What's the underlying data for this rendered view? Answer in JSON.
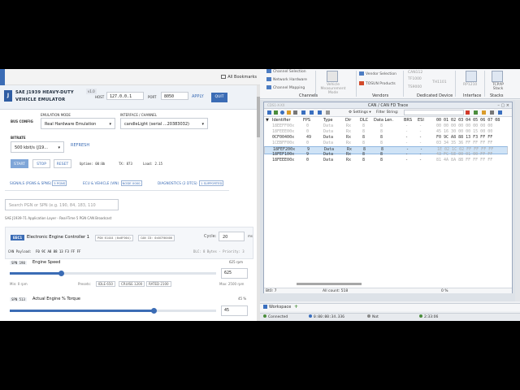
{
  "left": {
    "bookmarks_label": "All Bookmarks",
    "app": {
      "logo_letter": "J",
      "title_line1": "SAE J1939 HEAVY-DUTY",
      "title_line2": "VEHICLE EMULATOR",
      "version": "v1.0",
      "host_label": "HOST",
      "host_value": "127.0.0.1",
      "port_label": "PORT",
      "port_value": "8050",
      "apply_label": "APPLY",
      "quit_label": "QUIT"
    },
    "bus_config": {
      "section_label": "BUS CONFIG",
      "emulation_mode_label": "EMULATION MODE",
      "emulation_mode_value": "Real Hardware Emulation",
      "interface_label": "INTERFACE / CHANNEL",
      "interface_value": "candleLight (serial ...20383032)",
      "bitrate_label": "BITRATE",
      "bitrate_value": "500 kbit/s (J19...",
      "refresh_label": "REFRESH",
      "start_label": "START",
      "stop_label": "STOP",
      "reset_label": "RESET",
      "uptime": "Uptime: 00:0b",
      "tx": "TX: 873",
      "load": "Load: 2.15"
    },
    "tabs": [
      {
        "label": "SIGNALS (PGNS & SPNS)",
        "count": "5 PGNS"
      },
      {
        "label": "ECU & VEHICLE (VIN)",
        "count": "NODE 0000"
      },
      {
        "label": "DIAGNOSTICS (2 DTCS)",
        "count": "1 SUPPORTED"
      }
    ],
    "search_placeholder": "Search PGN or SPN (e.g. 190, 84, 183, 110",
    "app_layer_line": "SAE J1939-71 Application Layer - Real-Time 5 PGN CAN Broadcast",
    "ecu_card": {
      "tag": "EEC1",
      "name": "Electronic Engine Controller 1",
      "pgn_pill": "PGN 61444 (0x0F004)",
      "can_pill": "CAN ID: 0x0CF00400",
      "cycle_label": "Cycle:",
      "cycle_value": "20",
      "cycle_unit": "ms",
      "payload_label": "CAN Payload:",
      "payload_value": "F0 9C A8 88 13 F3 FF FF",
      "dlc_line": "DLC: 8 Bytes - Priority: 3"
    },
    "signals": [
      {
        "spn": "SPN 190",
        "name": "Engine Speed",
        "value_text": "625 rpm",
        "input_value": "625",
        "min_label": "Min: 0 rpm",
        "max_label": "Max: 2500 rpm",
        "presets_label": "Presets:",
        "presets": [
          "IDLE 650",
          "CRUISE 1200",
          "RATED 2100"
        ],
        "level": 0.25
      },
      {
        "spn": "SPN 513",
        "name": "Actual Engine % Torque",
        "value_text": "45 %",
        "input_value": "45",
        "level": 0.7
      }
    ]
  },
  "right": {
    "ribbon": {
      "channel_items": [
        "Channel Selection",
        "Network Hardware",
        "Channel Mapping"
      ],
      "vehicle_btn": "Vehicle Measurement Mode",
      "vendor_items": [
        "Vendor Selection",
        "TOSUN Products"
      ],
      "dedicated_items": [
        "CAN112",
        "TF1000",
        "TH1101",
        "TS9000"
      ],
      "interface_item": "RP1210",
      "stacks_item": "TCP/IP Stack",
      "groups": [
        "Channels",
        "Vendors",
        "Dedicated Device",
        "Interface",
        "Stacks"
      ]
    },
    "trace": {
      "title": "CAN / CAN FD Trace",
      "subtitle": "CDS1-X-XX",
      "settings_label": "Settings",
      "filter_label": "Filter String:",
      "columns": [
        "Identifier",
        "FPS",
        "Type",
        "Dir",
        "DLC",
        "Data Len.",
        "BRS",
        "ESI",
        "00 01 02 03 04 05 06 07 08"
      ],
      "rows": [
        {
          "id": "18EEFF00x",
          "fps": "0",
          "type": "Data",
          "dir": "Rx",
          "dlc": "8",
          "len": "8",
          "brs": "-",
          "esi": "-",
          "data": "00 00 00 00 00 00 00 00",
          "style": "dim"
        },
        {
          "id": "18FEEE00x",
          "fps": "0",
          "type": "Data",
          "dir": "Rx",
          "dlc": "8",
          "len": "8",
          "brs": "-",
          "esi": "-",
          "data": "45 16 30 00 00 15 00 00",
          "style": "dim"
        },
        {
          "id": "0CF00400x",
          "fps": "49",
          "type": "Data",
          "dir": "Rx",
          "dlc": "8",
          "len": "8",
          "brs": "-",
          "esi": "-",
          "data": "F0 9C A8 88 13 F3 FF FF",
          "style": "norm"
        },
        {
          "id": "1CEBFF00x",
          "fps": "0",
          "type": "Data",
          "dir": "Rx",
          "dlc": "8",
          "len": "8",
          "brs": "-",
          "esi": "-",
          "data": "03 34 35 36 FF FF FF FF",
          "style": "dim"
        },
        {
          "id": "18FEF200x",
          "fps": "9",
          "type": "Data",
          "dir": "Rx",
          "dlc": "8",
          "len": "8",
          "brs": "-",
          "esi": "-",
          "data": "1E 02 1C 02 FF FF FF FF",
          "style": "sel"
        },
        {
          "id": "18FEF100x",
          "fps": "9",
          "type": "Data",
          "dir": "Rx",
          "dlc": "8",
          "len": "8",
          "brs": "-",
          "esi": "-",
          "data": "43 FC 5E 00 01 00 FF FF",
          "style": "norm"
        },
        {
          "id": "18FEEE00x",
          "fps": "0",
          "type": "Data",
          "dir": "Rx",
          "dlc": "8",
          "len": "8",
          "brs": "-",
          "esi": "-",
          "data": "81 4A 8A 8B FF FF FF FF",
          "style": "norm"
        }
      ],
      "status_left": "Bt0: 7",
      "status_mid": "All count: 518",
      "status_right": "0 %"
    },
    "workspace_label": "Workspace",
    "statusbar": {
      "connected1": "Connected",
      "time": "0:00:00:34.336",
      "logging": "Not logging",
      "connected2": "2:33:06 PM: Application connected"
    }
  }
}
